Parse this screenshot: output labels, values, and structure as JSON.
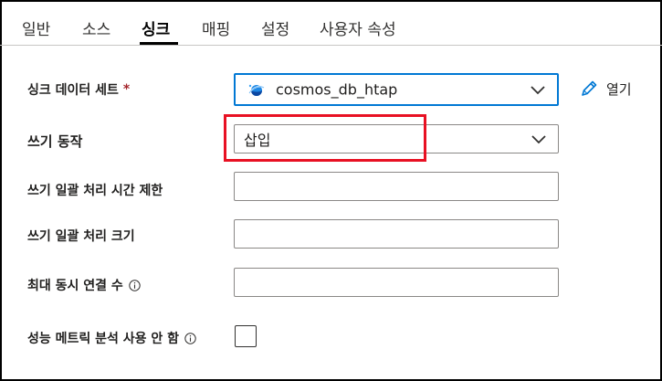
{
  "tabs": [
    {
      "label": "일반"
    },
    {
      "label": "소스"
    },
    {
      "label": "싱크"
    },
    {
      "label": "매핑"
    },
    {
      "label": "설정"
    },
    {
      "label": "사용자 속성"
    }
  ],
  "active_tab": "싱크",
  "form": {
    "sink_dataset": {
      "label": "싱크 데이터 세트",
      "required_mark": "*",
      "value": "cosmos_db_htap",
      "icon": "cosmos-db-icon"
    },
    "open_link": {
      "label": "열기",
      "icon": "pencil-icon"
    },
    "write_behavior": {
      "label": "쓰기 동작",
      "value": "삽입"
    },
    "write_batch_timeout": {
      "label": "쓰기 일괄 처리 시간 제한",
      "value": ""
    },
    "write_batch_size": {
      "label": "쓰기 일괄 처리 크기",
      "value": ""
    },
    "max_concurrent_connections": {
      "label": "최대 동시 연결 수",
      "value": "",
      "icon": "info-icon"
    },
    "performance_metrics": {
      "label": "성능 메트릭 분석 사용 안 함",
      "checked": false,
      "icon": "info-icon"
    }
  },
  "colors": {
    "focus_border": "#0078d4",
    "highlight": "#e81123",
    "required": "#a4262c"
  }
}
